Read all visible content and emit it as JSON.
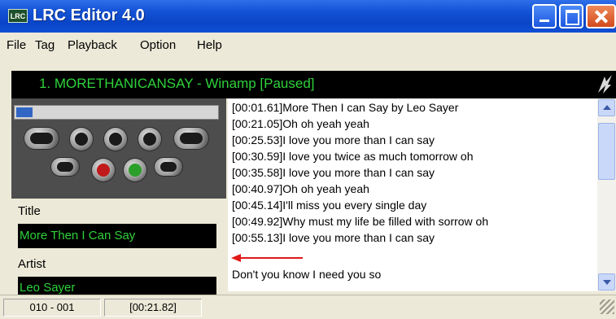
{
  "window": {
    "title": "LRC Editor 4.0",
    "icon_label": "LRC"
  },
  "menu": [
    "File",
    "Tag",
    "Playback",
    "Option",
    "Help"
  ],
  "now_playing": "1. MORETHANICANSAY - Winamp [Paused]",
  "player": {
    "progress": 0.08,
    "buttons_row1": [
      "previous-button",
      "play-button",
      "pause-button",
      "stop-button",
      "next-button"
    ],
    "buttons_row2": [
      "rewind-button",
      "record-button",
      "tag-button",
      "forward-button"
    ]
  },
  "fields": {
    "title_label": "Title",
    "title_value": "More Then I Can Say",
    "artist_label": "Artist",
    "artist_value": "Leo Sayer"
  },
  "lyrics": [
    "[00:01.61]More Then I can Say by Leo Sayer",
    "[00:21.05]Oh oh yeah yeah",
    "[00:25.53]I love you more than I can say",
    "[00:30.59]I love you twice as much tomorrow oh",
    "[00:35.58]I love you more than I can say",
    "[00:40.97]Oh oh yeah yeah",
    "[00:45.14]I'll miss you every single day",
    "[00:49.92]Why must my life be filled with sorrow oh",
    "[00:55.13]I love you more than I can say",
    "",
    "Don't you know I need you so"
  ],
  "status": {
    "line": "010 - 001",
    "time": "[00:21.82]"
  },
  "colors": {
    "accent_green": "#2fd13b",
    "arrow_red": "#e01818",
    "seek_blue": "#3166c4"
  }
}
